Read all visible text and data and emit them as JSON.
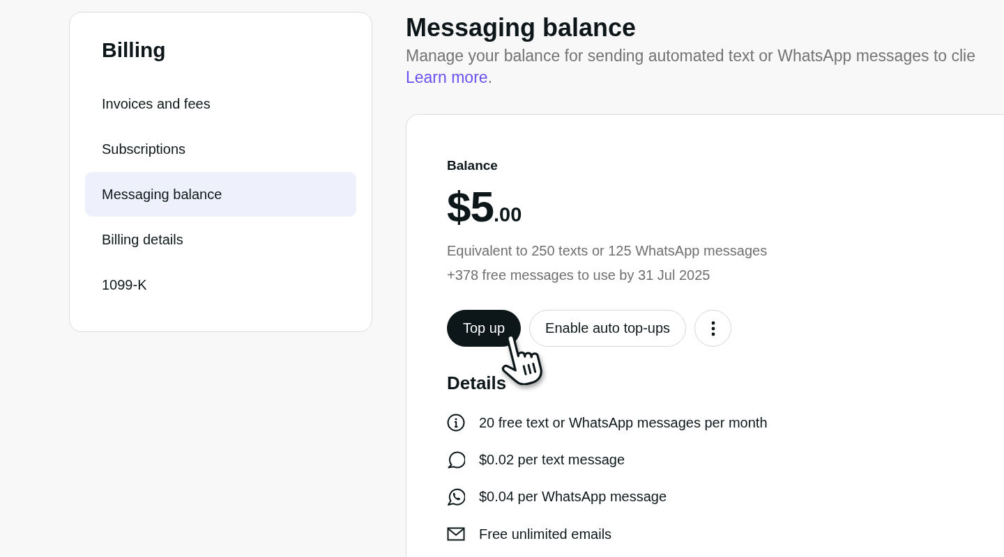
{
  "sidebar": {
    "title": "Billing",
    "items": [
      {
        "label": "Invoices and fees",
        "selected": false
      },
      {
        "label": "Subscriptions",
        "selected": false
      },
      {
        "label": "Messaging balance",
        "selected": true
      },
      {
        "label": "Billing details",
        "selected": false
      },
      {
        "label": "1099-K",
        "selected": false
      }
    ]
  },
  "header": {
    "title": "Messaging balance",
    "description": "Manage your balance for sending automated text or WhatsApp messages to clie",
    "link": "Learn more",
    "link_suffix": "."
  },
  "balance_card": {
    "label": "Balance",
    "amount": "$5",
    "amount_cents": ".00",
    "equivalent": "Equivalent to 250 texts or 125 WhatsApp messages",
    "free_messages": "+378 free messages to use by 31 Jul 2025",
    "buttons": [
      {
        "kind": "primary",
        "label": "Top up"
      },
      {
        "kind": "secondary",
        "label": "Enable auto top-ups"
      },
      {
        "kind": "more"
      }
    ],
    "details": {
      "title": "Details",
      "items": [
        {
          "kind": "info",
          "text": "20 free text or WhatsApp messages per month"
        },
        {
          "kind": "sms",
          "text": "$0.02 per text message"
        },
        {
          "kind": "whatsapp",
          "text": "$0.04 per WhatsApp message"
        },
        {
          "kind": "email",
          "text": "Free unlimited emails"
        }
      ]
    }
  }
}
